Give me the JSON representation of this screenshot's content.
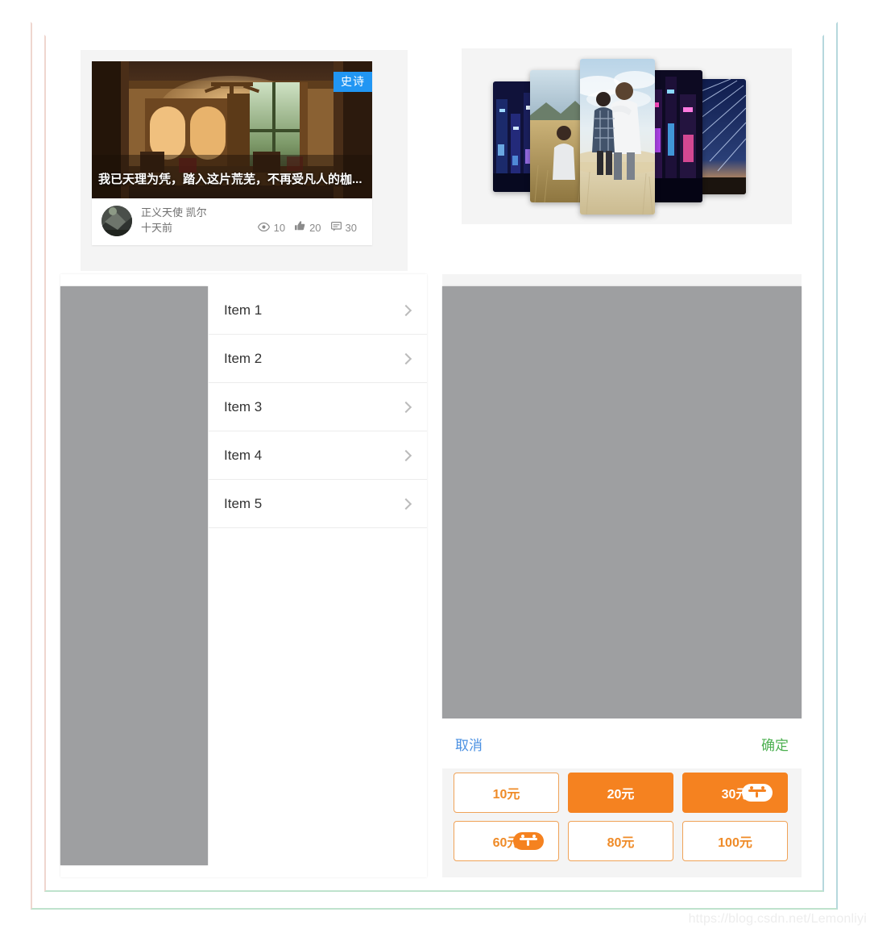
{
  "colors": {
    "accent_orange": "#f58220",
    "badge_blue": "#2196f3",
    "cancel_blue": "#4a90e2",
    "confirm_green": "#4cb050",
    "placeholder_gray": "#9e9fa1",
    "panel_bg": "#f4f4f4",
    "frame_green": "#bfe3cd",
    "frame_pink": "#efd6cf",
    "frame_blue": "#b6d8dd"
  },
  "article_card": {
    "badge_label": "史诗",
    "title": "我已天理为凭，踏入这片荒芜，不再受凡人的枷...",
    "author": "正义天使 凯尔",
    "time": "十天前",
    "stats": [
      {
        "icon": "eye-icon",
        "value": "10"
      },
      {
        "icon": "thumbs-up-icon",
        "value": "20"
      },
      {
        "icon": "comment-icon",
        "value": "30"
      }
    ]
  },
  "swiper": {
    "slides": [
      {
        "name": "slide-neon-city-left",
        "kind": "neon"
      },
      {
        "name": "slide-wheat-field",
        "kind": "field"
      },
      {
        "name": "slide-couple-center",
        "kind": "couple"
      },
      {
        "name": "slide-neon-city-right",
        "kind": "neon2"
      },
      {
        "name": "slide-star-trails",
        "kind": "stars"
      }
    ]
  },
  "list": {
    "items": [
      {
        "label": "Item 1"
      },
      {
        "label": "Item 2"
      },
      {
        "label": "Item 3"
      },
      {
        "label": "Item 4"
      },
      {
        "label": "Item 5"
      }
    ]
  },
  "picker": {
    "cancel_label": "取消",
    "confirm_label": "确定"
  },
  "recharge": {
    "options": [
      {
        "label": "10元",
        "selected": false,
        "gift": false
      },
      {
        "label": "20元",
        "selected": true,
        "gift": false
      },
      {
        "label": "30元",
        "selected": true,
        "gift": true
      },
      {
        "label": "60元",
        "selected": false,
        "gift": true
      },
      {
        "label": "80元",
        "selected": false,
        "gift": false
      },
      {
        "label": "100元",
        "selected": false,
        "gift": false
      }
    ]
  },
  "watermark": {
    "text": "https://blog.csdn.net/Lemonliyi"
  }
}
